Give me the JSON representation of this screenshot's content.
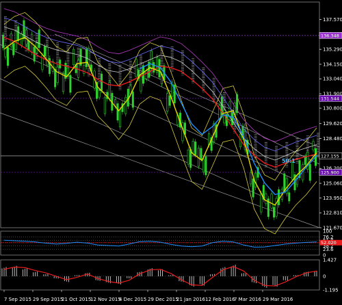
{
  "chart_data": [
    {
      "type": "line",
      "title": "",
      "panel": "price",
      "ylim": [
        121.67,
        138.9
      ],
      "y_ticks": [
        {
          "value": 137.57,
          "label": "137.570"
        },
        {
          "value": 136.485,
          "label": "136.485"
        },
        {
          "value": 135.29,
          "label": "135.290"
        },
        {
          "value": 134.15,
          "label": "134.150"
        },
        {
          "value": 133.04,
          "label": "133.040"
        },
        {
          "value": 131.9,
          "label": "131.900"
        },
        {
          "value": 130.8,
          "label": "130.800"
        },
        {
          "value": 129.62,
          "label": "129.620"
        },
        {
          "value": 128.48,
          "label": "128.480"
        },
        {
          "value": 126.2,
          "label": "126.200"
        },
        {
          "value": 125.06,
          "label": "125.060"
        },
        {
          "value": 123.95,
          "label": "123.950"
        },
        {
          "value": 122.81,
          "label": "122.810"
        },
        {
          "value": 121.67,
          "label": "121.670"
        }
      ],
      "x_labels": [
        "7 Sep 2015",
        "29 Sep 2015",
        "21 Oct 2015",
        "12 Nov 2015",
        "4 Dec 2015",
        "29 Dec 2015",
        "21 Jan 2016",
        "12 Feb 2016",
        "7 Mar 2016",
        "29 Mar 2016"
      ],
      "price_tags": [
        {
          "value": 136.348,
          "label": "136.348",
          "color": "#9b30d0"
        },
        {
          "value": 131.544,
          "label": "131.544",
          "color": "#6a0dad"
        },
        {
          "value": 127.155,
          "label": "127.155",
          "color": "#000000"
        },
        {
          "value": 125.9,
          "label": "125.900",
          "color": "#6a0dad"
        }
      ],
      "annotation": "50:1",
      "series": [
        {
          "values": [
            136.2,
            135.9,
            135.4,
            134.9,
            134.5,
            134.2,
            134.0,
            133.8,
            133.5,
            133.0,
            132.6,
            132.5,
            132.8,
            133.2,
            133.6,
            134.0,
            133.9,
            133.6,
            133.0,
            132.3,
            131.5,
            130.4,
            129.2,
            128.0,
            127.2,
            126.6,
            126.3,
            126.6,
            126.9,
            127.1,
            127.3
          ],
          "color": "#e81c1c"
        },
        {
          "values": [
            135.3,
            135.9,
            136.2,
            135.5,
            134.6,
            133.6,
            133.2,
            134.2,
            134.3,
            132.4,
            131.6,
            130.6,
            131.6,
            133.3,
            133.9,
            133.6,
            131.7,
            129.5,
            127.4,
            126.8,
            128.6,
            130.4,
            130.6,
            128.4,
            125.3,
            123.8,
            123.4,
            124.6,
            125.6,
            126.4,
            127.4
          ],
          "color": "#e8d800"
        },
        {
          "values": [
            null,
            null,
            null,
            null,
            null,
            null,
            null,
            null,
            null,
            null,
            null,
            null,
            null,
            133.8,
            134.2,
            133.9,
            132.8,
            131.2,
            129.6,
            128.8,
            129.4,
            130.3,
            130.1,
            128.6,
            126.6,
            125.1,
            124.2,
            124.4,
            125.3,
            126.3,
            127.2
          ],
          "color": "#1e8fff"
        }
      ]
    },
    {
      "type": "line",
      "panel": "oscillator_1",
      "ylim": [
        0,
        100
      ],
      "y_ticks": [
        {
          "value": 100,
          "label": "100"
        },
        {
          "value": 76.2,
          "label": "76.2"
        },
        {
          "value": 61.8,
          "label": "61.8"
        },
        {
          "value": 38.2,
          "label": "38.2"
        },
        {
          "value": 23.6,
          "label": "23.6"
        },
        {
          "value": 0,
          "label": "0"
        }
      ],
      "price_tags": [
        {
          "value": 52,
          "label": "52.020",
          "color": "#e81c1c"
        }
      ],
      "series": [
        {
          "values": [
            62,
            60,
            58,
            55,
            50,
            46,
            49,
            54,
            50,
            42,
            40,
            38,
            46,
            56,
            58,
            54,
            45,
            38,
            35,
            38,
            52,
            58,
            55,
            42,
            33,
            34,
            40,
            46,
            50,
            53,
            55
          ],
          "color": "#1e8fff"
        }
      ]
    },
    {
      "type": "bar",
      "panel": "oscillator_2",
      "ylim": [
        -1.195,
        1.427
      ],
      "y_ticks": [
        {
          "value": 1.427,
          "label": "1.427"
        },
        {
          "value": 0,
          "label": "0"
        },
        {
          "value": -1.195,
          "label": "-1.195"
        }
      ],
      "values": [
        0.8,
        0.9,
        0.7,
        0.4,
        0.2,
        -0.2,
        -0.5,
        0.1,
        0.3,
        -0.4,
        -0.6,
        -0.7,
        -0.2,
        0.4,
        0.7,
        0.6,
        0.1,
        -0.5,
        -0.9,
        -0.8,
        0.2,
        0.8,
        1.0,
        0.3,
        -0.6,
        -1.0,
        -0.9,
        -0.4,
        0.1,
        0.4,
        0.5
      ],
      "series": [
        {
          "values": [
            0.6,
            0.8,
            0.75,
            0.5,
            0.3,
            0.0,
            -0.3,
            -0.1,
            0.2,
            -0.2,
            -0.45,
            -0.6,
            -0.35,
            0.2,
            0.55,
            0.6,
            0.25,
            -0.3,
            -0.75,
            -0.8,
            -0.1,
            0.55,
            0.85,
            0.45,
            -0.35,
            -0.8,
            -0.85,
            -0.5,
            -0.05,
            0.3,
            0.45
          ],
          "color": "#e81c1c"
        }
      ]
    }
  ]
}
